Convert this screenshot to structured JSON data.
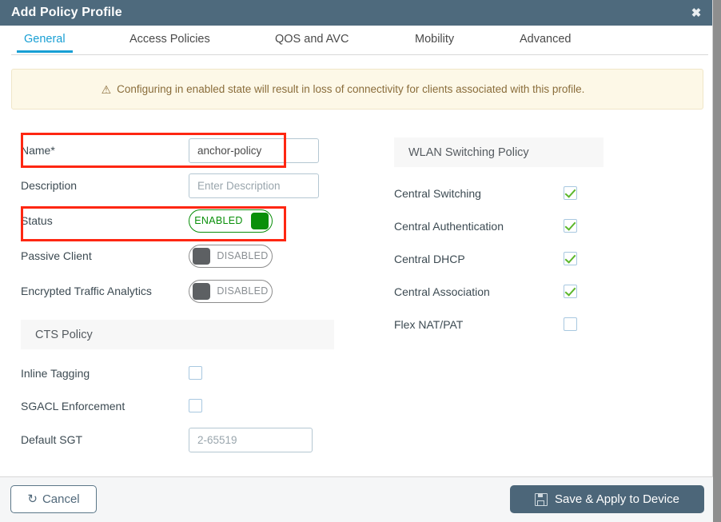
{
  "window": {
    "title": "Add Policy Profile",
    "close_icon": "close-x-icon"
  },
  "tabs": [
    {
      "label": "General",
      "active": true
    },
    {
      "label": "Access Policies",
      "active": false
    },
    {
      "label": "QOS and AVC",
      "active": false
    },
    {
      "label": "Mobility",
      "active": false
    },
    {
      "label": "Advanced",
      "active": false
    }
  ],
  "warning": {
    "icon": "warning-triangle-icon",
    "text": "Configuring in enabled state will result in loss of connectivity for clients associated with this profile."
  },
  "general": {
    "name": {
      "label": "Name*",
      "value": "anchor-policy"
    },
    "description": {
      "label": "Description",
      "value": "",
      "placeholder": "Enter Description"
    },
    "status": {
      "label": "Status",
      "state": "ENABLED"
    },
    "passive_client": {
      "label": "Passive Client",
      "state": "DISABLED"
    },
    "encrypted_traffic_analytics": {
      "label": "Encrypted Traffic Analytics",
      "state": "DISABLED"
    }
  },
  "cts_policy": {
    "title": "CTS Policy",
    "inline_tagging": {
      "label": "Inline Tagging",
      "checked": false
    },
    "sgacl_enforcement": {
      "label": "SGACL Enforcement",
      "checked": false
    },
    "default_sgt": {
      "label": "Default SGT",
      "value": "",
      "placeholder": "2-65519"
    }
  },
  "wlan_switching_policy": {
    "title": "WLAN Switching Policy",
    "items": [
      {
        "label": "Central Switching",
        "checked": true
      },
      {
        "label": "Central Authentication",
        "checked": true
      },
      {
        "label": "Central DHCP",
        "checked": true
      },
      {
        "label": "Central Association",
        "checked": true
      },
      {
        "label": "Flex NAT/PAT",
        "checked": false
      }
    ]
  },
  "footer": {
    "cancel_label": "Cancel",
    "cancel_icon": "undo-arrow-icon",
    "save_label": "Save & Apply to Device",
    "save_icon": "floppy-disk-icon"
  },
  "colors": {
    "titlebar": "#4e6a7d",
    "accent_tab": "#189fd4",
    "warning_bg": "#fdf8e7",
    "warning_text": "#8a6d3b",
    "enabled_green": "#0a8f0a",
    "check_green": "#5cb72c",
    "save_button": "#4c6679",
    "annotation_red": "#fe2712"
  }
}
